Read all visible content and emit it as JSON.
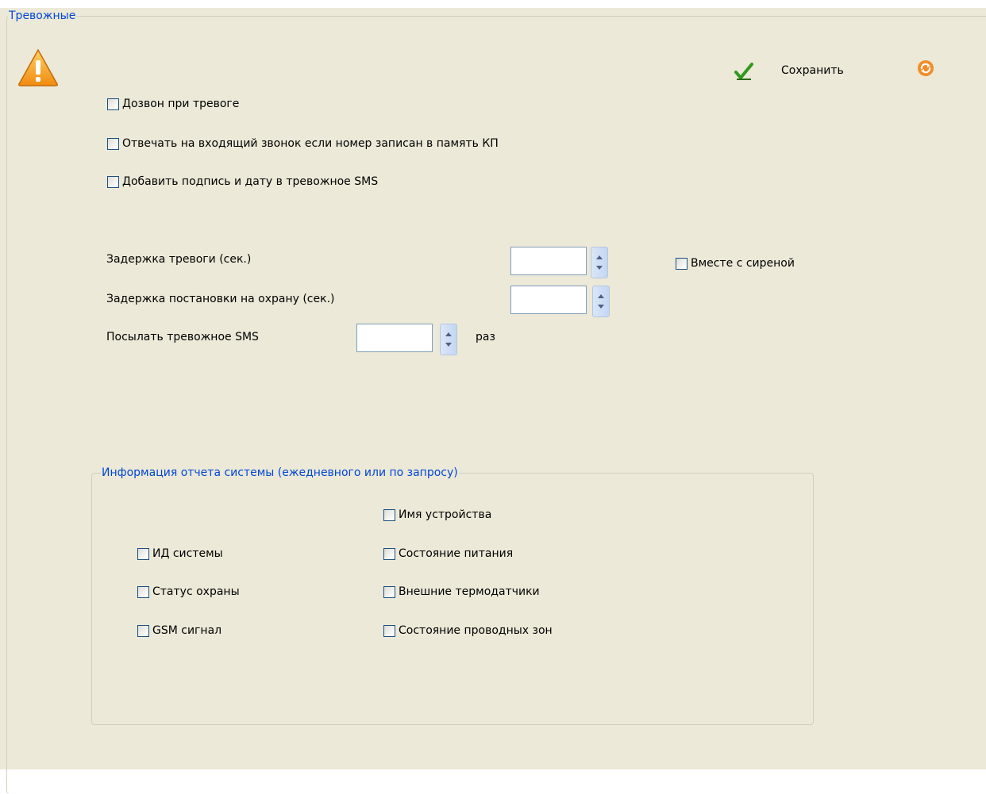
{
  "group_title": "Тревожные",
  "icons": {
    "warning": "warning-triangle-icon",
    "save": "green-checkmark-icon",
    "refresh": "orange-refresh-icon"
  },
  "colors": {
    "panel_bg": "#ece9d8",
    "legend_text": "#0046d5",
    "warning": "#f7a21b",
    "check_green": "#2f9a1b",
    "refresh_orange": "#f28c28"
  },
  "toolbar": {
    "save_label": "Сохранить"
  },
  "options": {
    "call_on_alarm": {
      "label": "Дозвон при тревоге",
      "checked": false
    },
    "answer_incoming": {
      "label": "Отвечать на входящий звонок если номер записан в память КП",
      "checked": false
    },
    "add_signature": {
      "label": "Добавить подпись и дату в тревожное SMS",
      "checked": false
    }
  },
  "fields": {
    "alarm_delay": {
      "label": "Задержка тревоги (сек.)",
      "value": ""
    },
    "arm_delay": {
      "label": "Задержка постановки на охрану (сек.)",
      "value": ""
    },
    "sms_count": {
      "label": "Посылать тревожное SMS",
      "value": "",
      "suffix": "раз"
    }
  },
  "with_siren": {
    "label": "Вместе с сиреной",
    "checked": false
  },
  "report": {
    "title": "Информация отчета системы (ежедневного или по запросу)",
    "items": {
      "device_name": {
        "label": "Имя устройства",
        "checked": false
      },
      "system_id": {
        "label": "ИД системы",
        "checked": false
      },
      "power_state": {
        "label": "Состояние питания",
        "checked": false
      },
      "arm_status": {
        "label": "Статус охраны",
        "checked": false
      },
      "ext_thermo": {
        "label": "Внешние термодатчики",
        "checked": false
      },
      "gsm_signal": {
        "label": "GSM сигнал",
        "checked": false
      },
      "wired_zones": {
        "label": "Состояние проводных зон",
        "checked": false
      }
    }
  }
}
